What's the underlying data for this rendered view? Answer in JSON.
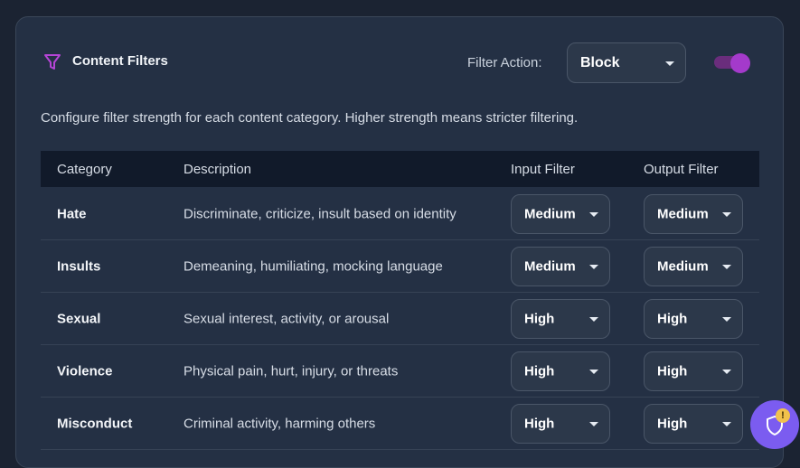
{
  "header": {
    "title": "Content Filters",
    "filter_action_label": "Filter Action:",
    "filter_action_value": "Block",
    "toggle_on": true
  },
  "description": "Configure filter strength for each content category. Higher strength means stricter filtering.",
  "table": {
    "columns": [
      "Category",
      "Description",
      "Input Filter",
      "Output Filter"
    ],
    "rows": [
      {
        "category": "Hate",
        "description": "Discriminate, criticize, insult based on identity",
        "input": "Medium",
        "output": "Medium"
      },
      {
        "category": "Insults",
        "description": "Demeaning, humiliating, mocking language",
        "input": "Medium",
        "output": "Medium"
      },
      {
        "category": "Sexual",
        "description": "Sexual interest, activity, or arousal",
        "input": "High",
        "output": "High"
      },
      {
        "category": "Violence",
        "description": "Physical pain, hurt, injury, or threats",
        "input": "High",
        "output": "High"
      },
      {
        "category": "Misconduct",
        "description": "Criminal activity, harming others",
        "input": "High",
        "output": "High"
      }
    ]
  },
  "fab": {
    "badge": "!"
  },
  "colors": {
    "accent": "#a43acb",
    "fab": "#7b5cf0",
    "badge": "#f1c14c"
  }
}
